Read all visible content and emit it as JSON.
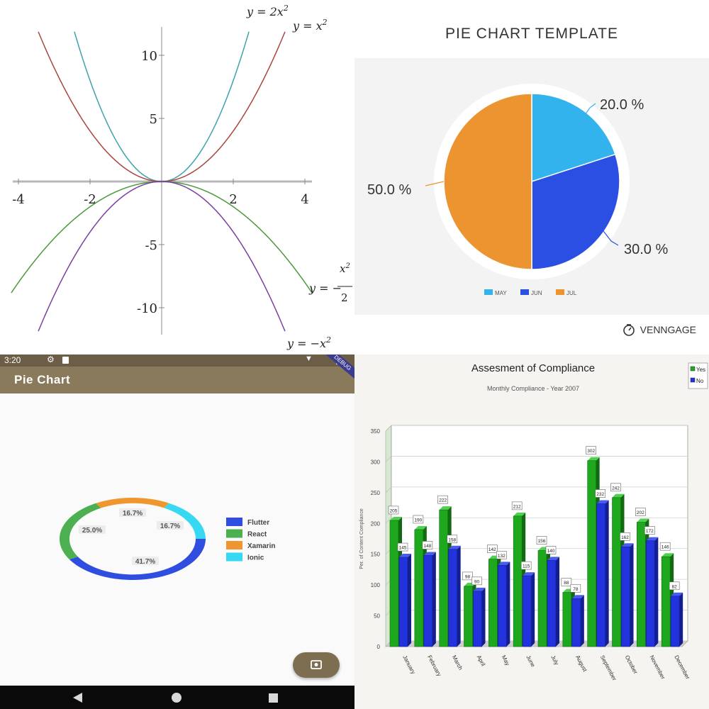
{
  "chart_data": [
    {
      "type": "line",
      "title": "",
      "xlabel": "",
      "ylabel": "",
      "xlim": [
        -4.2,
        4.2
      ],
      "ylim": [
        -12,
        12
      ],
      "xticks": [
        -4,
        -2,
        2,
        4
      ],
      "yticks": [
        10,
        5,
        -5,
        -10
      ],
      "xtick_labels": [
        "-4",
        "-2",
        "2",
        "4"
      ],
      "ytick_labels": [
        "10",
        "5",
        "-5",
        "-10"
      ],
      "series": [
        {
          "name": "y = 2x",
          "exp": "2",
          "coef": 2,
          "color": "#3ea2ad"
        },
        {
          "name": "y = x",
          "exp": "2",
          "coef": 1,
          "color": "#a8453f"
        },
        {
          "name": "y = −",
          "frac_num": "x2",
          "frac_den": "2",
          "coef": -0.5,
          "color": "#4a9a3a"
        },
        {
          "name": "y = −x",
          "exp": "2",
          "coef": -1,
          "color": "#7a3fa0"
        }
      ]
    },
    {
      "type": "pie",
      "title": "PIE CHART TEMPLATE",
      "categories": [
        "MAY",
        "JUN",
        "JUL"
      ],
      "values": [
        20.0,
        30.0,
        50.0
      ],
      "data_labels": [
        "20.0 %",
        "30.0 %",
        "50.0 %"
      ],
      "colors": [
        "#33b3ee",
        "#2b4fe3",
        "#ec9430"
      ],
      "legend": "bottom",
      "brand": "VENNGAGE"
    },
    {
      "type": "pie",
      "variant": "donut",
      "title": "Pie Chart",
      "status_time": "3:20",
      "debug_banner": "DEBUG",
      "categories": [
        "Flutter",
        "React",
        "Xamarin",
        "Ionic"
      ],
      "values": [
        41.7,
        25.0,
        16.7,
        16.7
      ],
      "data_labels": [
        "41.7%",
        "25.0%",
        "16.7%",
        "16.7%"
      ],
      "colors": [
        "#2f4ee0",
        "#4caf50",
        "#f0962e",
        "#36d8f2"
      ],
      "legend": "right"
    },
    {
      "type": "bar",
      "title": "Assesment of Compliance",
      "subtitle": "Monthly Compliance - Year 2007",
      "ylabel": "Per. of Content Compliance",
      "ylim": [
        0,
        350
      ],
      "yticks": [
        0,
        50,
        100,
        150,
        200,
        250,
        300,
        350
      ],
      "categories": [
        "January",
        "February",
        "March",
        "April",
        "May",
        "June",
        "July",
        "August",
        "September",
        "October",
        "November",
        "December"
      ],
      "series": [
        {
          "name": "Yes",
          "color": "#1ea81e",
          "values": [
            205,
            190,
            222,
            98,
            142,
            212,
            156,
            88,
            302,
            242,
            202,
            146
          ]
        },
        {
          "name": "No",
          "color": "#2233dd",
          "values": [
            145,
            148,
            158,
            90,
            132,
            115,
            140,
            78,
            232,
            162,
            172,
            82
          ]
        }
      ],
      "data_labels_yes": [
        "205",
        "190",
        "222",
        "98",
        "142",
        "212",
        "156",
        "88",
        "302",
        "242",
        "202",
        "146"
      ],
      "data_labels_no": [
        "145",
        "148",
        "158",
        "90",
        "132",
        "115",
        "140",
        "78",
        "232",
        "162",
        "172",
        "82"
      ],
      "legend": "top-right",
      "grid": true
    }
  ]
}
